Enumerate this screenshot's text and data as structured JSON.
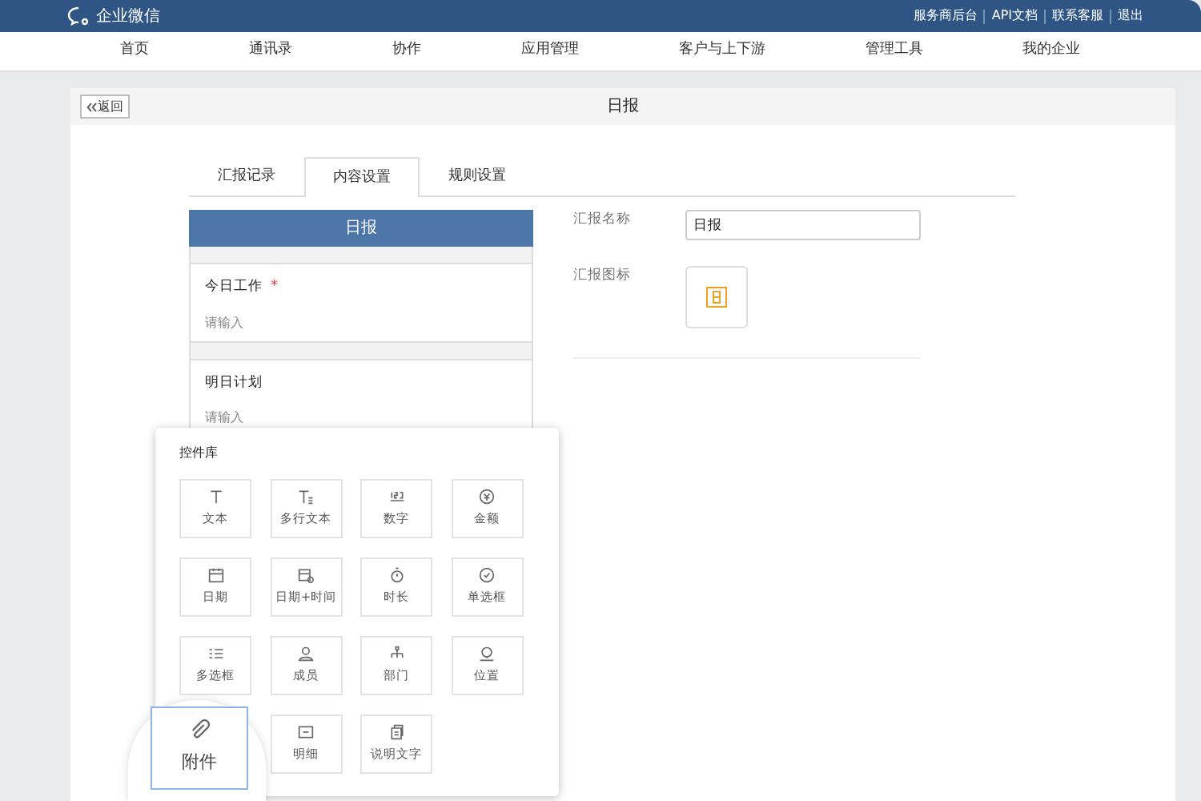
{
  "topbar": {
    "brand": "企业微信",
    "links": [
      "服务商后台",
      "API文档",
      "联系客服",
      "退出"
    ]
  },
  "nav": [
    "首页",
    "通讯录",
    "协作",
    "应用管理",
    "客户与上下游",
    "管理工具",
    "我的企业"
  ],
  "page": {
    "back": "返回",
    "title": "日报"
  },
  "tabs": [
    {
      "label": "汇报记录",
      "selected": false
    },
    {
      "label": "内容设置",
      "selected": true
    },
    {
      "label": "规则设置",
      "selected": false
    }
  ],
  "form_preview": {
    "title": "日报",
    "fields": [
      {
        "label": "今日工作",
        "required_mark": "*",
        "placeholder": "请输入"
      },
      {
        "label": "明日计划",
        "placeholder": "请输入"
      }
    ]
  },
  "settings": {
    "name_label": "汇报名称",
    "name_value": "日报",
    "icon_label": "汇报图标"
  },
  "widget_library": {
    "title": "控件库",
    "items": [
      {
        "kind": "text",
        "label": "文本",
        "magnified": false
      },
      {
        "kind": "multiline",
        "label": "多行文本",
        "magnified": false
      },
      {
        "kind": "number",
        "label": "数字",
        "magnified": false
      },
      {
        "kind": "amount",
        "label": "金额",
        "magnified": false
      },
      {
        "kind": "date",
        "label": "日期",
        "magnified": false
      },
      {
        "kind": "datetime",
        "label": "日期+时间",
        "magnified": false
      },
      {
        "kind": "duration",
        "label": "时长",
        "magnified": false
      },
      {
        "kind": "radio",
        "label": "单选框",
        "magnified": false
      },
      {
        "kind": "checklist",
        "label": "多选框",
        "magnified": false
      },
      {
        "kind": "member",
        "label": "成员",
        "magnified": false
      },
      {
        "kind": "department",
        "label": "部门",
        "magnified": false
      },
      {
        "kind": "location",
        "label": "位置",
        "magnified": false
      },
      {
        "kind": "attachment",
        "label": "附件",
        "magnified": true
      },
      {
        "kind": "detail",
        "label": "明细",
        "magnified": false
      },
      {
        "kind": "description",
        "label": "说明文字",
        "magnified": false
      }
    ]
  }
}
